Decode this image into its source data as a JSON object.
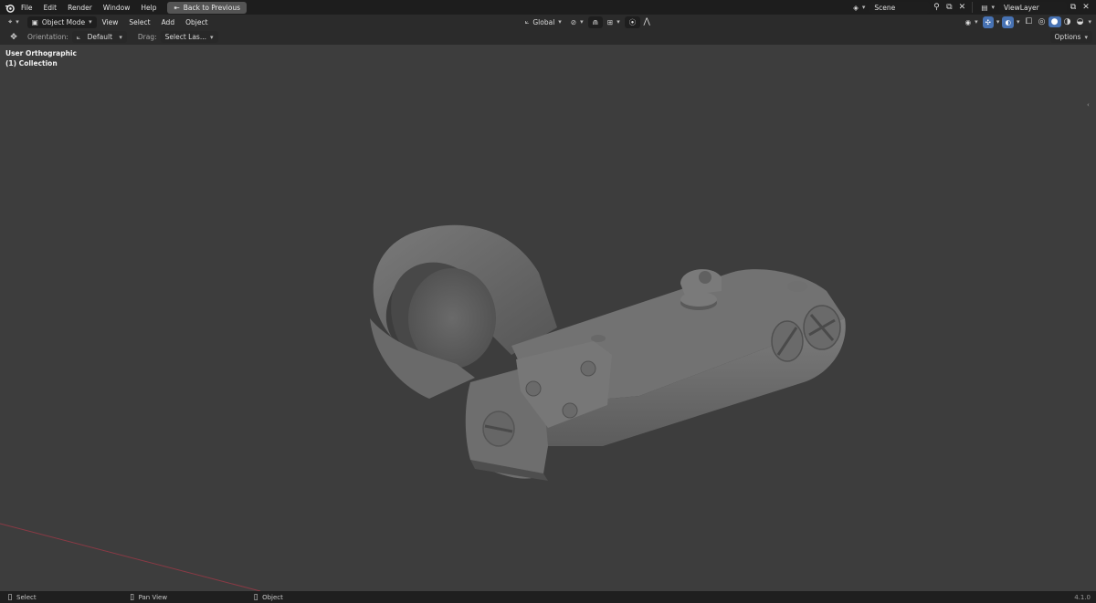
{
  "topbar": {
    "menus": [
      "File",
      "Edit",
      "Render",
      "Window",
      "Help"
    ],
    "back_button": "Back to Previous",
    "scene_name": "Scene",
    "viewlayer_name": "ViewLayer"
  },
  "view_header": {
    "mode": "Object Mode",
    "menus": [
      "View",
      "Select",
      "Add",
      "Object"
    ],
    "transform_orientation": "Global"
  },
  "tool_settings": {
    "orientation_label": "Orientation:",
    "orientation_value": "Default",
    "drag_label": "Drag:",
    "drag_value": "Select Las...",
    "options": "Options"
  },
  "viewport": {
    "view_name": "User Orthographic",
    "collection": "(1) Collection"
  },
  "statusbar": {
    "select": "Select",
    "pan": "Pan View",
    "object": "Object",
    "version": "4.1.0"
  },
  "colors": {
    "background": "#3d3d3d",
    "header": "#2b2b2b",
    "topbar": "#1d1d1d",
    "accent": "#4772b3",
    "x_axis": "#8a3a45"
  }
}
